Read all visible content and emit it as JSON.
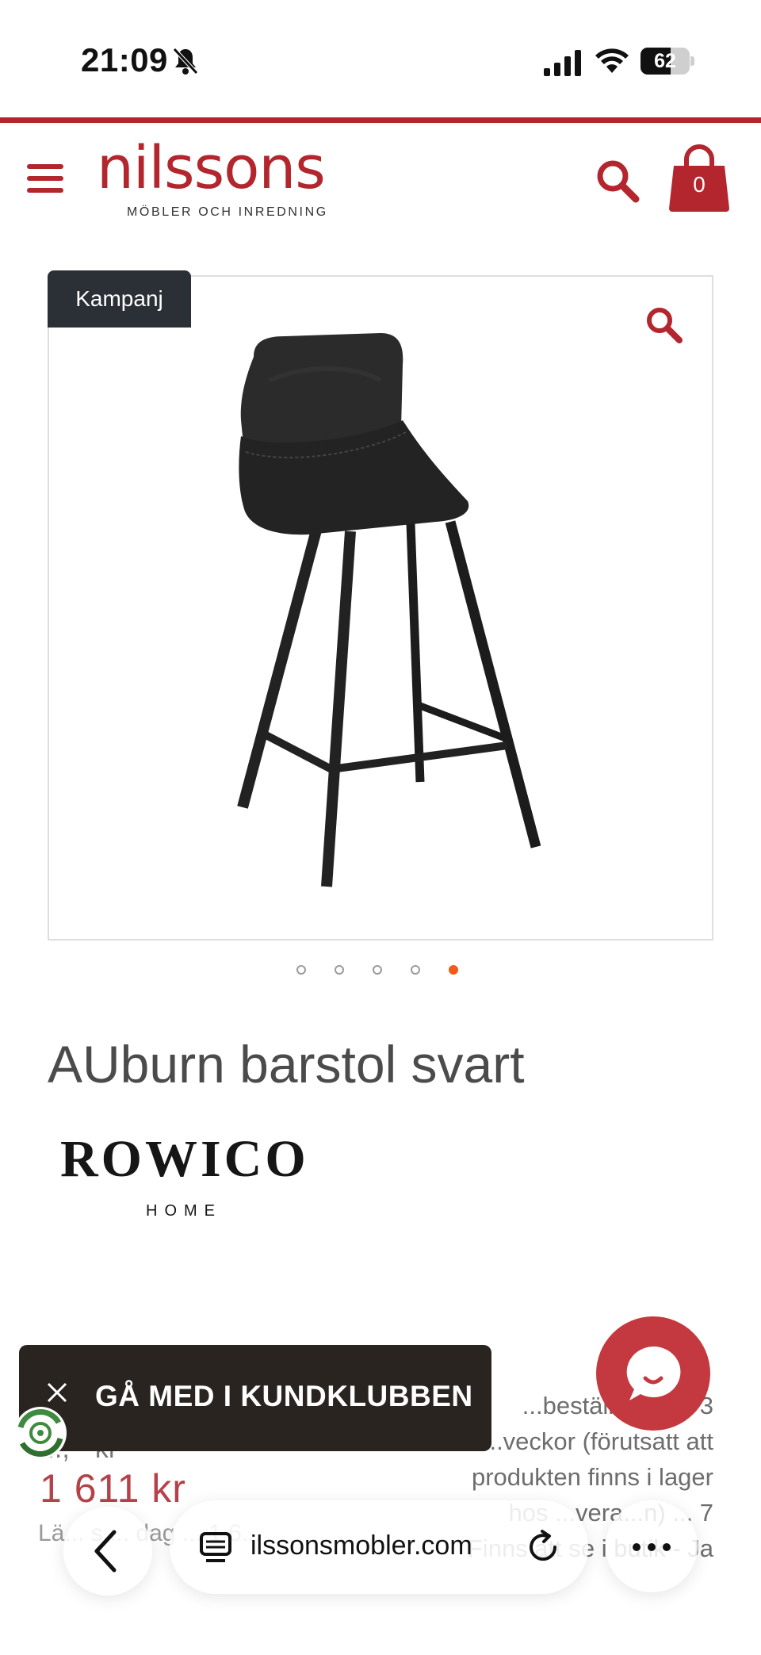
{
  "status_bar": {
    "time": "21:09",
    "battery": "62",
    "battery_level": 0.62
  },
  "header": {
    "logo_word": "nilssons",
    "logo_tagline": "MÖBLER OCH INREDNING",
    "cart_count": "0",
    "icons": [
      "hamburger-menu-icon",
      "search-icon",
      "shopping-bag-icon"
    ],
    "brand_color": "#b3262e"
  },
  "product": {
    "badge": "Kampanj",
    "title": "AUburn barstol svart",
    "brand_name": "ROWICO",
    "brand_sub": "HOME",
    "image_count": 5,
    "active_image_index": 5,
    "old_price_partial": "...,-- kr",
    "price": "1 611 kr",
    "price_note_partial": "Lä... s ... dag ... 1 6...",
    "delivery_text": "...beställnings... 3 ...veckor (förutsatt att produkten finns i lager hos ...vera...n) ... 7 Finns att se i butik - Ja",
    "price_color": "#b54248",
    "dot_active_color": "#f05a1a"
  },
  "club_banner": {
    "label": "GÅ MED I KUNDKLUBBEN",
    "bg_color": "#2a2420"
  },
  "chat": {
    "color": "#c4393f"
  },
  "browser": {
    "url": "nilssonsmobler.com",
    "url_visible": "ilssonsmobler.com",
    "icons": [
      "back-chevron-icon",
      "tabs-icon",
      "reload-icon",
      "more-icon"
    ]
  }
}
